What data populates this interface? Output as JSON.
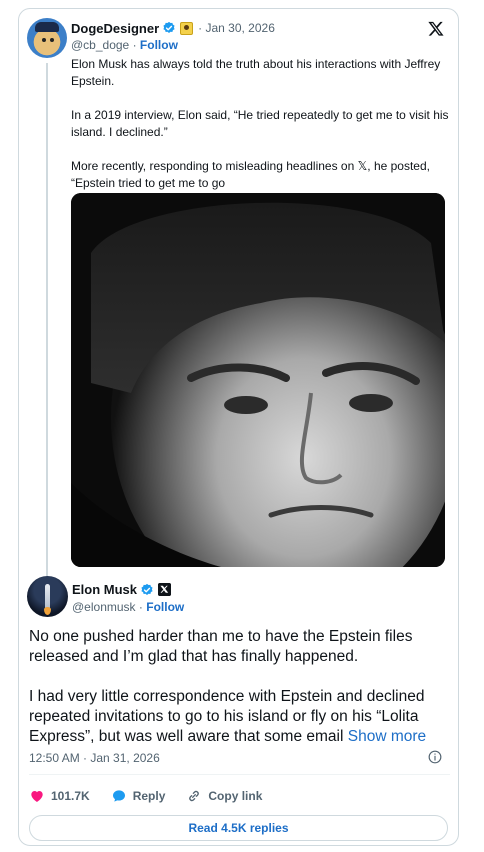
{
  "quoted": {
    "name": "DogeDesigner",
    "handle": "@cb_doge",
    "separator": "·",
    "follow_label": "Follow",
    "date": "· Jan 30, 2026",
    "paragraphs": [
      "Elon Musk has always told the truth about his interactions with Jeffrey Epstein.",
      "In a 2019 interview, Elon said, “He tried repeatedly to get me to visit his island. I declined.”",
      "More recently, responding to misleading headlines on 𝕏, he posted, “Epstein tried to get me to go"
    ],
    "icons": [
      "doge-avatar",
      "verified-badge-icon",
      "affiliate-badge-icon",
      "x-logo-icon"
    ]
  },
  "main": {
    "name": "Elon Musk",
    "handle": "@elonmusk",
    "separator": "·",
    "follow_label": "Follow",
    "paragraph1": "No one pushed harder than me to have the Epstein files released and I’m glad that has finally happened.",
    "paragraph2": "I had very little correspondence with Epstein and declined repeated invitations to go to his island or fly on his “Lolita Express”, but was well aware that some email",
    "show_more": "Show more",
    "timestamp": "12:50 AM · Jan 31, 2026"
  },
  "actions": {
    "likes": "101.7K",
    "reply_label": "Reply",
    "copy_label": "Copy link",
    "read_replies": "Read 4.5K replies"
  },
  "colors": {
    "link_blue": "#1d6ec7",
    "verified_blue": "#1d9bf0",
    "like_red": "#f91880",
    "muted": "#536471"
  }
}
